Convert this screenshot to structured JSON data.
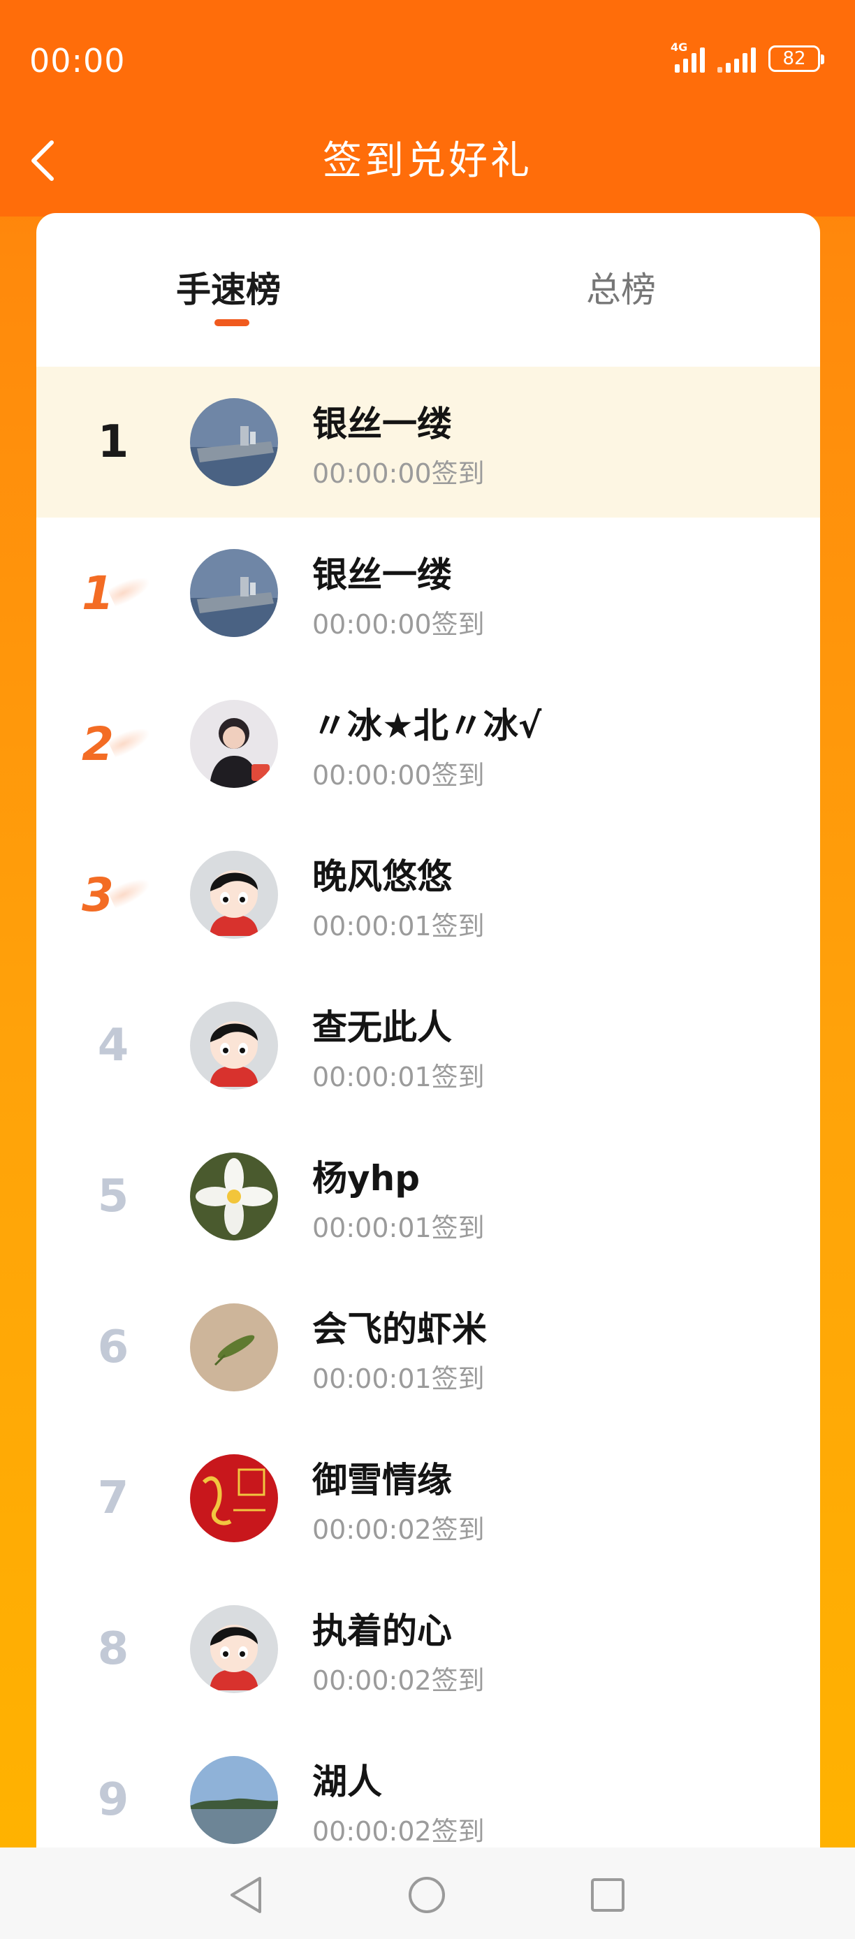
{
  "status_bar": {
    "time": "00:00",
    "network": "4G",
    "battery": "82"
  },
  "header": {
    "title": "签到兑好礼"
  },
  "tabs": [
    {
      "label": "手速榜",
      "active": true
    },
    {
      "label": "总榜",
      "active": false
    }
  ],
  "current_user": {
    "rank": "1",
    "name": "银丝一缕",
    "time": "00:00:00签到"
  },
  "rankings": [
    {
      "rank": "1",
      "name": "银丝一缕",
      "time": "00:00:00签到",
      "avatar": "aircraft-carrier"
    },
    {
      "rank": "2",
      "name": "〃冰★北〃冰√",
      "time": "00:00:00签到",
      "avatar": "person-photo"
    },
    {
      "rank": "3",
      "name": "晚风悠悠",
      "time": "00:00:01签到",
      "avatar": "cartoon-boy"
    },
    {
      "rank": "4",
      "name": "查无此人",
      "time": "00:00:01签到",
      "avatar": "cartoon-boy"
    },
    {
      "rank": "5",
      "name": "杨yhp",
      "time": "00:00:01签到",
      "avatar": "white-flower"
    },
    {
      "rank": "6",
      "name": "会飞的虾米",
      "time": "00:00:01签到",
      "avatar": "mantis"
    },
    {
      "rank": "7",
      "name": "御雪情缘",
      "time": "00:00:02签到",
      "avatar": "red-dragon"
    },
    {
      "rank": "8",
      "name": "执着的心",
      "time": "00:00:02签到",
      "avatar": "cartoon-boy"
    },
    {
      "rank": "9",
      "name": "湖人",
      "time": "00:00:02签到",
      "avatar": "lake-landscape"
    }
  ],
  "colors": {
    "header": "#ff6d0a",
    "accent": "#f36c24",
    "highlight_row": "#fdf6e3"
  }
}
